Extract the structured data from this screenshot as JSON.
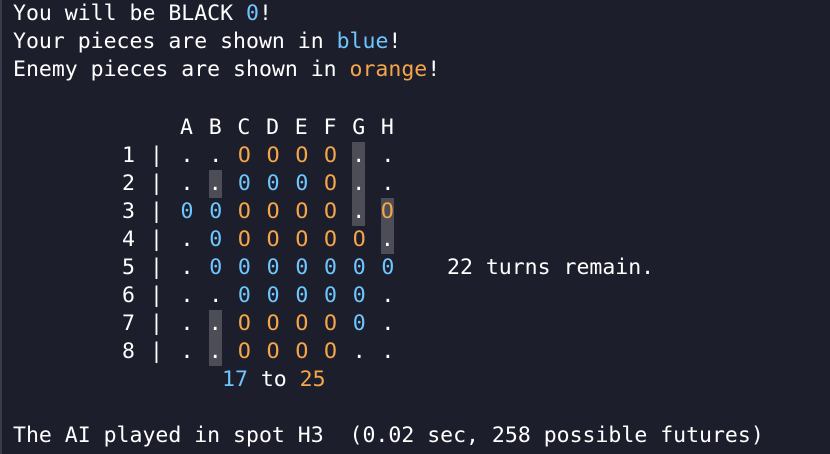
{
  "intro": {
    "line1_prefix": "You will be BLACK ",
    "line1_symbol": "0",
    "line1_suffix": "!",
    "line2_prefix": "Your pieces are shown in ",
    "line2_color_word": "blue",
    "line2_suffix": "!",
    "line3_prefix": "Enemy pieces are shown in ",
    "line3_color_word": "orange",
    "line3_suffix": "!"
  },
  "board": {
    "columns": [
      "A",
      "B",
      "C",
      "D",
      "E",
      "F",
      "G",
      "H"
    ],
    "rows": [
      {
        "label": "1",
        "cells": [
          ".",
          ".",
          "O",
          "O",
          "O",
          "O",
          ".",
          "."
        ],
        "owner": [
          "",
          "",
          "orange",
          "orange",
          "orange",
          "orange",
          "",
          ""
        ],
        "highlight": [
          false,
          false,
          false,
          false,
          false,
          false,
          true,
          false
        ]
      },
      {
        "label": "2",
        "cells": [
          ".",
          ".",
          "0",
          "0",
          "0",
          "O",
          ".",
          "."
        ],
        "owner": [
          "",
          "",
          "blue",
          "blue",
          "blue",
          "orange",
          "",
          ""
        ],
        "highlight": [
          false,
          true,
          false,
          false,
          false,
          false,
          true,
          false
        ]
      },
      {
        "label": "3",
        "cells": [
          "0",
          "0",
          "O",
          "O",
          "O",
          "O",
          ".",
          "O"
        ],
        "owner": [
          "blue",
          "blue",
          "orange",
          "orange",
          "orange",
          "orange",
          "",
          "orange"
        ],
        "highlight": [
          false,
          false,
          false,
          false,
          false,
          false,
          true,
          true
        ]
      },
      {
        "label": "4",
        "cells": [
          ".",
          "0",
          "O",
          "O",
          "O",
          "O",
          "O",
          "."
        ],
        "owner": [
          "",
          "blue",
          "orange",
          "orange",
          "orange",
          "orange",
          "orange",
          ""
        ],
        "highlight": [
          false,
          false,
          false,
          false,
          false,
          false,
          false,
          true
        ]
      },
      {
        "label": "5",
        "cells": [
          ".",
          "0",
          "0",
          "0",
          "0",
          "0",
          "0",
          "0"
        ],
        "owner": [
          "",
          "blue",
          "blue",
          "blue",
          "blue",
          "blue",
          "blue",
          "blue"
        ],
        "highlight": [
          false,
          false,
          false,
          false,
          false,
          false,
          false,
          false
        ]
      },
      {
        "label": "6",
        "cells": [
          ".",
          ".",
          "0",
          "0",
          "0",
          "0",
          "0",
          "."
        ],
        "owner": [
          "",
          "",
          "blue",
          "blue",
          "blue",
          "blue",
          "blue",
          ""
        ],
        "highlight": [
          false,
          false,
          false,
          false,
          false,
          false,
          false,
          false
        ]
      },
      {
        "label": "7",
        "cells": [
          ".",
          ".",
          "O",
          "O",
          "O",
          "O",
          "0",
          "."
        ],
        "owner": [
          "",
          "",
          "orange",
          "orange",
          "orange",
          "orange",
          "blue",
          ""
        ],
        "highlight": [
          false,
          true,
          false,
          false,
          false,
          false,
          false,
          false
        ]
      },
      {
        "label": "8",
        "cells": [
          ".",
          ".",
          "O",
          "O",
          "O",
          "O",
          ".",
          "."
        ],
        "owner": [
          "",
          "",
          "orange",
          "orange",
          "orange",
          "orange",
          "",
          ""
        ],
        "highlight": [
          false,
          true,
          false,
          false,
          false,
          false,
          false,
          false
        ]
      }
    ],
    "separator": "|"
  },
  "score": {
    "blue_count": "17",
    "word": " to ",
    "orange_count": "25"
  },
  "turns": {
    "text": "22 turns remain."
  },
  "ai_message": {
    "text": "The AI played in spot H3  (0.02 sec, 258 possible futures)"
  },
  "colors": {
    "background": "#1d1e2b",
    "text": "#ffffff",
    "blue": "#6ec6ff",
    "orange": "#f5a64a",
    "highlight": "#4c4d56"
  }
}
